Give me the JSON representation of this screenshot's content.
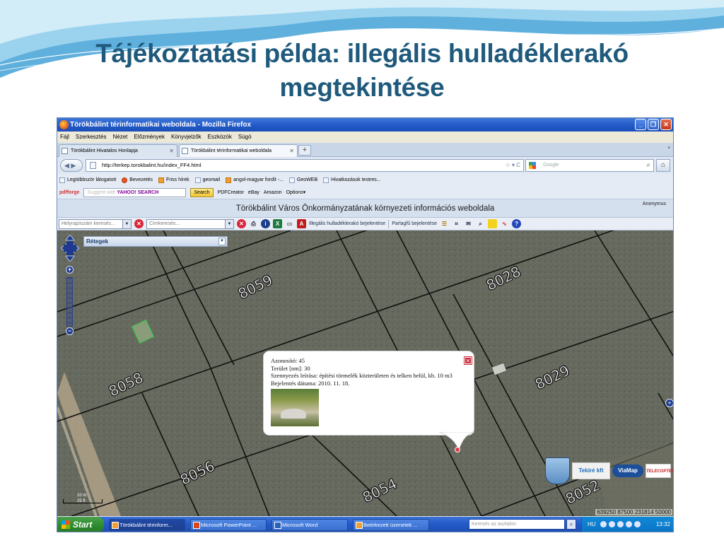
{
  "slide": {
    "title_line1": "Tájékoztatási példa: illegális hulladéklerakó",
    "title_line2": "megtekintése"
  },
  "window": {
    "title": "Törökbálint térinformatikai weboldala - Mozilla Firefox",
    "buttons": [
      "_",
      "❐",
      "✕"
    ]
  },
  "menu": [
    "Fájl",
    "Szerkesztés",
    "Nézet",
    "Előzmények",
    "Könyvjelzők",
    "Eszközök",
    "Súgó"
  ],
  "tabs": [
    {
      "label": "Törökbálint Hivatalos Honlapja",
      "close": "✕"
    },
    {
      "label": "Törökbálint térinformatikai weboldala",
      "close": "✕"
    }
  ],
  "tab_new": "+",
  "tab_scroll": "▾",
  "nav": {
    "back": "◀ ▶",
    "url": "http://terkep.torokbalint.hu/index_FF4.html",
    "url_right": "☆ ▾ C",
    "search_placeholder": "Google",
    "search_btn": "⌕",
    "home": "⌂"
  },
  "bookmarks": [
    "Legtöbbször látogatott",
    "Bevezetés",
    "Friss hírek",
    "geomail",
    "angol-magyar fordít -...",
    "GeoWEB",
    "Hivatkozások testres..."
  ],
  "toolbar2": {
    "pdfforge": "pdfforge",
    "yahoo_prefix": "Suggest with ",
    "yahoo_brand": "YAHOO! SEARCH",
    "search": "Search",
    "items": [
      "PDFCreator",
      "eBay",
      "Amazon",
      "Options▾"
    ]
  },
  "site": {
    "header": "Törökbálint Város Önkormányzatának környezeti információs weboldala",
    "user": "Anonymus"
  },
  "map_toolbar": {
    "address_search": "Helyrajziszám keresés...",
    "street_search": "Címkeresés...",
    "illegal_dump_link": "Illegális hulladéklerakó bejelentése",
    "ragweed_link": "Parlagfű bejelentése"
  },
  "map": {
    "layers_label": "Rétegek",
    "parcels": [
      "8059",
      "8028",
      "8058",
      "8029",
      "8056",
      "8054",
      "8052"
    ],
    "scale_label": "10 m",
    "scale_sub": "25 ft",
    "coordinates": "639250 87500  231814 50000",
    "logos": [
      "Tekiré kft",
      "ViaMap",
      "TELECOPTER"
    ]
  },
  "popup": {
    "id_label": "Azonosító:",
    "id_value": "45",
    "area_label": "Terület [nm]:",
    "area_value": "30",
    "desc_label": "Szennyezés leírása:",
    "desc_value": "építési törmelék közterületen és telken belül, kb. 10 m3",
    "date_label": "Bejelentés dátuma:",
    "date_value": "2010. 11. 18."
  },
  "taskbar": {
    "start": "Start",
    "tasks": [
      "Törökbálint térinform...",
      "Microsoft PowerPoint ...",
      "Microsoft Word",
      "Beérkezett üzenetek ..."
    ],
    "search_placeholder": "Keresés az asztalon",
    "lang": "HU",
    "clock": "13:32"
  },
  "colors": {
    "title": "#1f5a7c",
    "taskbar": "#245bc8",
    "start": "#2e8b2e"
  }
}
